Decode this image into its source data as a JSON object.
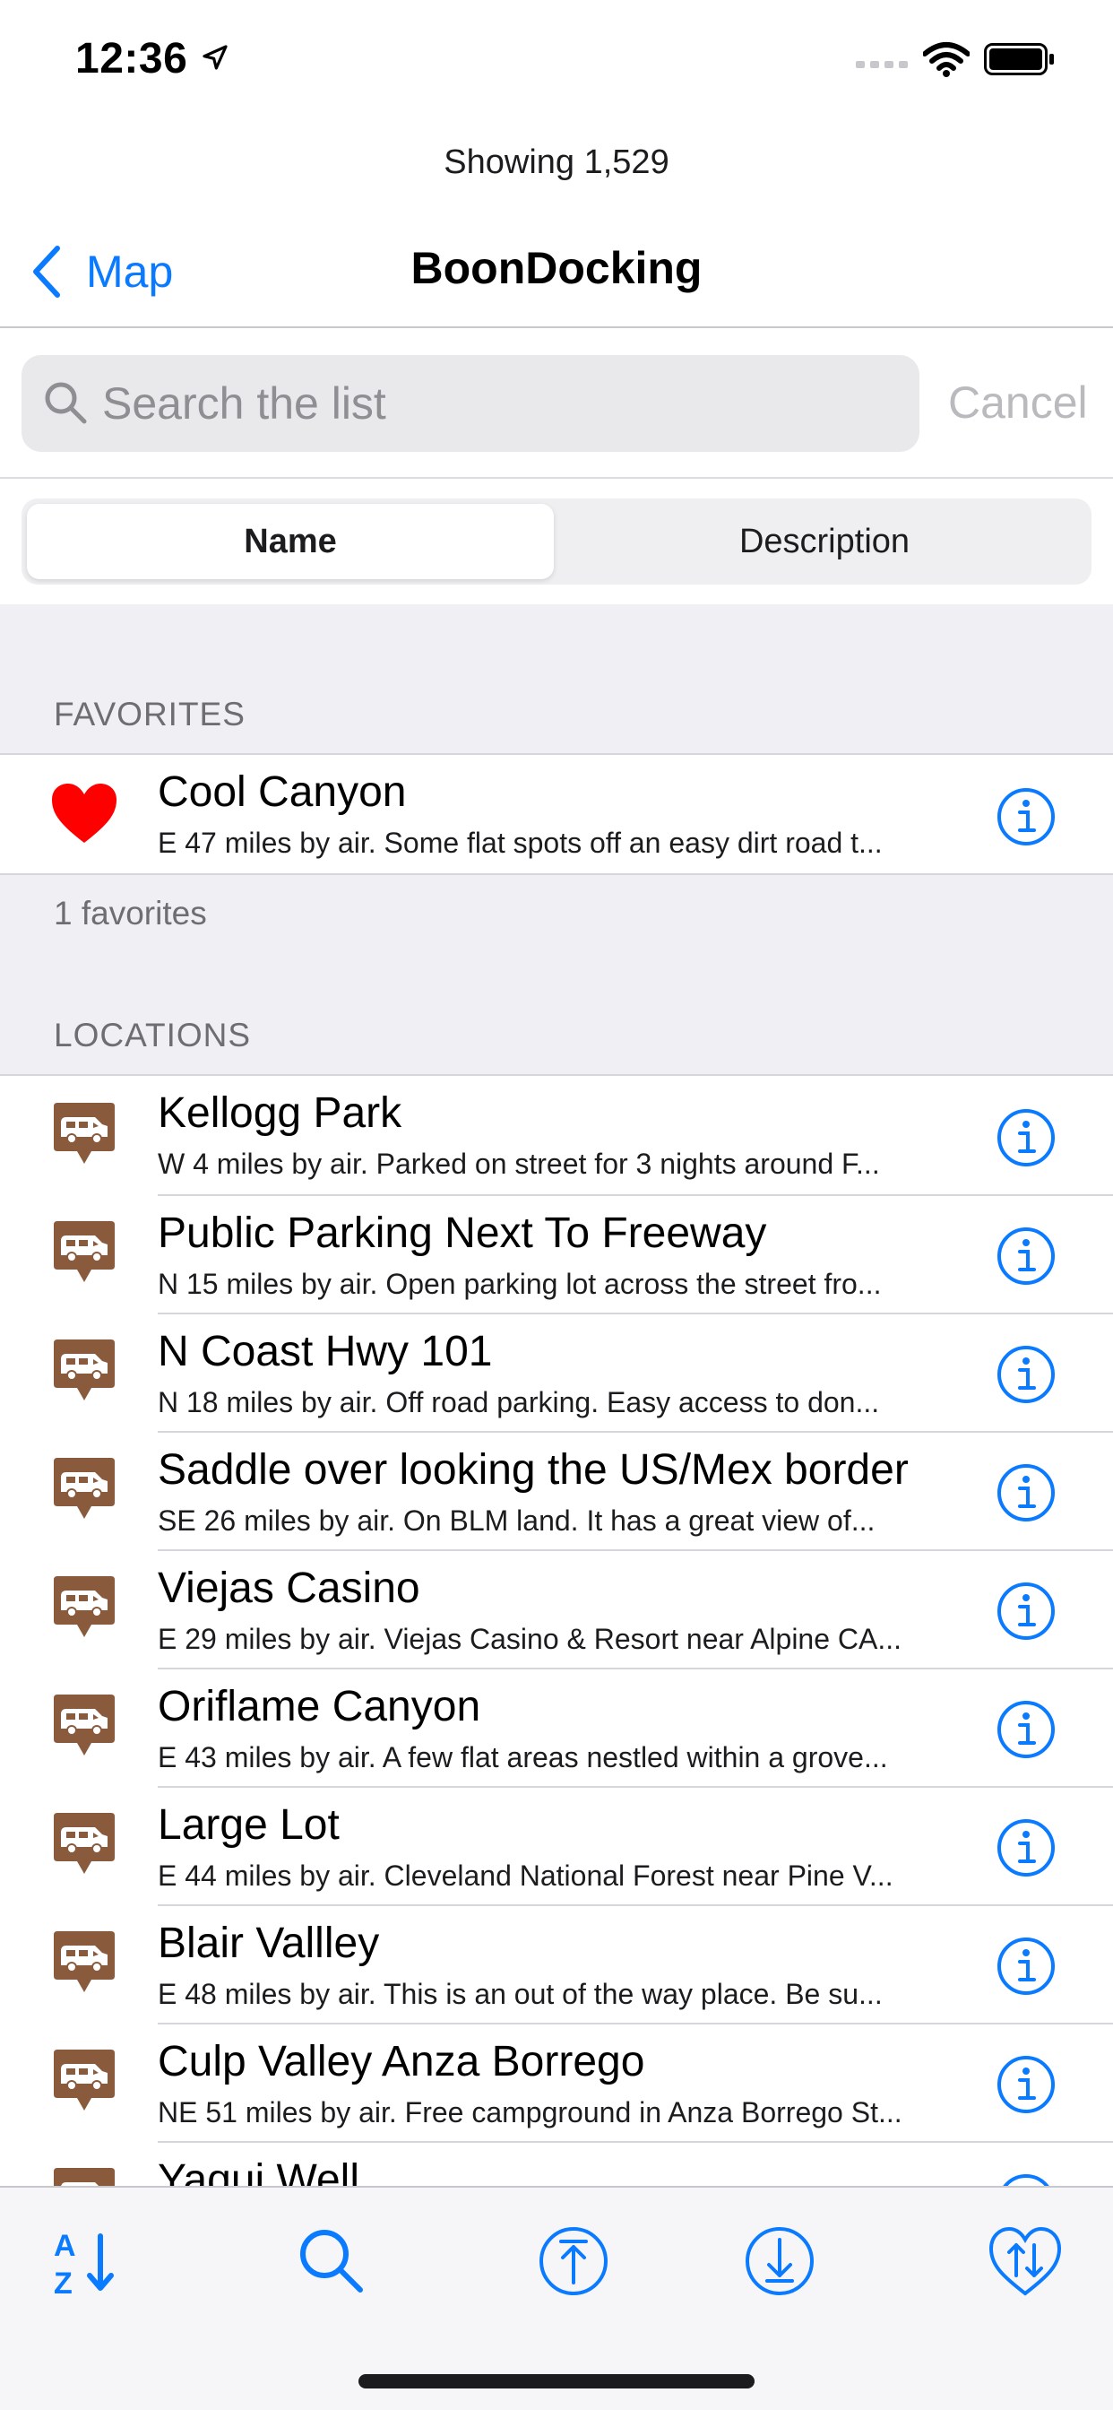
{
  "status_bar": {
    "time": "12:36"
  },
  "showing_text": "Showing 1,529",
  "nav": {
    "back_label": "Map",
    "title": "BoonDocking"
  },
  "search": {
    "placeholder": "Search the list",
    "cancel_label": "Cancel"
  },
  "segmented": {
    "active": "Name",
    "inactive": "Description"
  },
  "favorites": {
    "header": "FAVORITES",
    "footer": "1 favorites",
    "items": [
      {
        "title": "Cool Canyon",
        "subtitle": "E 47 miles by air. Some flat spots off an easy dirt road t..."
      }
    ]
  },
  "locations": {
    "header": "LOCATIONS",
    "items": [
      {
        "title": "Kellogg Park",
        "subtitle": "W 4 miles by air. Parked on street for 3 nights around F..."
      },
      {
        "title": "Public Parking Next To Freeway",
        "subtitle": "N 15 miles by air. Open parking lot across the street fro..."
      },
      {
        "title": "N Coast Hwy 101",
        "subtitle": "N 18 miles by air. Off road parking.  Easy access to don..."
      },
      {
        "title": "Saddle over looking the US/Mex border",
        "subtitle": "SE 26 miles by air. On BLM land.  It has a great view of..."
      },
      {
        "title": "Viejas Casino",
        "subtitle": "E 29 miles by air. Viejas Casino & Resort near Alpine CA..."
      },
      {
        "title": "Oriflame Canyon",
        "subtitle": "E 43 miles by air. A few flat areas nestled within a grove..."
      },
      {
        "title": "Large Lot",
        "subtitle": "E 44 miles by air. Cleveland National Forest near Pine V..."
      },
      {
        "title": "Blair Vallley",
        "subtitle": "E 48 miles by air. This is an out of the way place.  Be su..."
      },
      {
        "title": "Culp Valley Anza Borrego",
        "subtitle": "NE 51 miles by air. Free campground in Anza Borrego St..."
      },
      {
        "title": "Yaqui Well",
        "subtitle": ""
      }
    ]
  },
  "icons": {
    "favorite": "heart-icon",
    "location": "rv-camper-pin-icon",
    "info": "info-circle-icon",
    "toolbar": [
      "sort-az-icon",
      "search-icon",
      "scroll-top-icon",
      "scroll-bottom-icon",
      "favorite-sort-icon"
    ]
  },
  "colors": {
    "accent": "#0a7aff",
    "pin_brown": "#8a5a3c",
    "heart": "#ff0000"
  }
}
